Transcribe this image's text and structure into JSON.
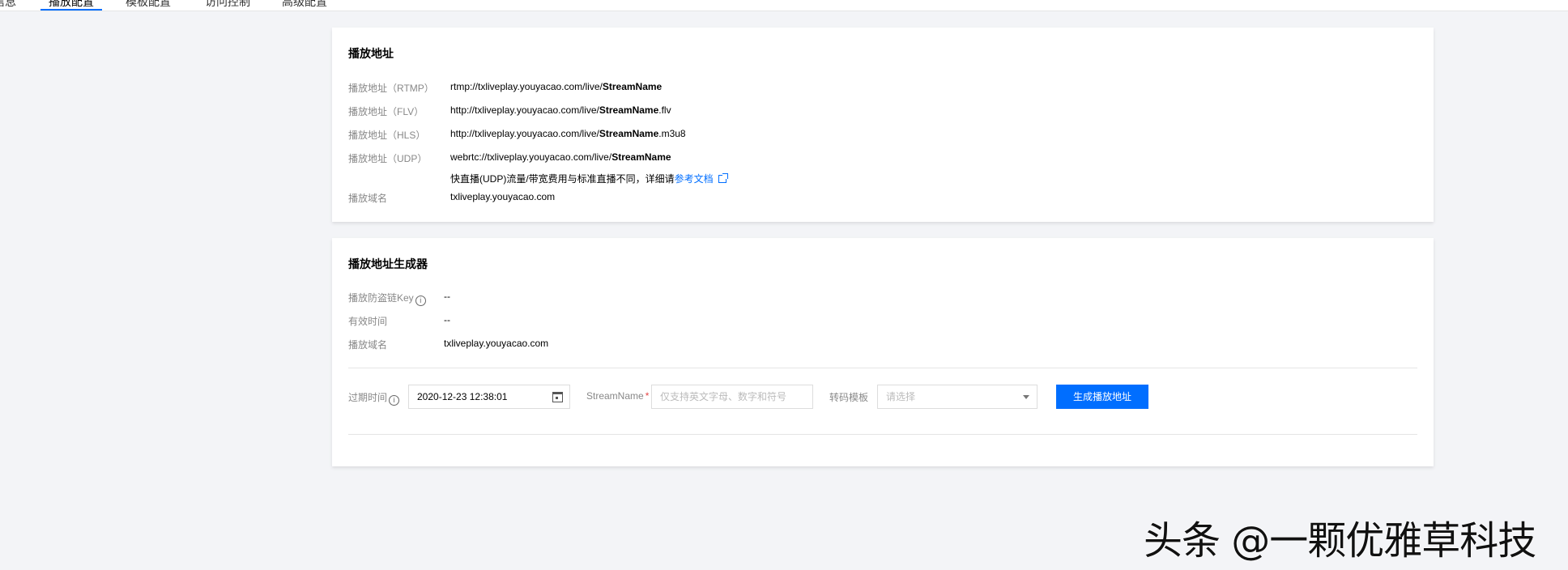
{
  "tabs": [
    {
      "label": "信息"
    },
    {
      "label": "播放配置"
    },
    {
      "label": "模板配置"
    },
    {
      "label": "访问控制"
    },
    {
      "label": "高级配置"
    }
  ],
  "play_address": {
    "title": "播放地址",
    "rows": [
      {
        "label": "播放地址（RTMP）",
        "prefix": "rtmp://txliveplay.youyacao.com/live/",
        "bold": "StreamName",
        "suffix": ""
      },
      {
        "label": "播放地址（FLV）",
        "prefix": "http://txliveplay.youyacao.com/live/",
        "bold": "StreamName",
        "suffix": ".flv"
      },
      {
        "label": "播放地址（HLS）",
        "prefix": "http://txliveplay.youyacao.com/live/",
        "bold": "StreamName",
        "suffix": ".m3u8"
      },
      {
        "label": "播放地址（UDP）",
        "prefix": "webrtc://txliveplay.youyacao.com/live/",
        "bold": "StreamName",
        "suffix": ""
      }
    ],
    "udp_hint": "快直播(UDP)流量/带宽费用与标准直播不同，详细请",
    "udp_hint_link": "参考文档",
    "domain_label": "播放域名",
    "domain_value": "txliveplay.youyacao.com"
  },
  "generator": {
    "title": "播放地址生成器",
    "key_label": "播放防盗链Key",
    "key_value": "--",
    "valid_label": "有效时间",
    "valid_value": "--",
    "domain_label": "播放域名",
    "domain_value": "txliveplay.youyacao.com",
    "expire_label": "过期时间",
    "expire_value": "2020-12-23 12:38:01",
    "stream_label": "StreamName",
    "stream_placeholder": "仅支持英文字母、数字和符号",
    "template_label": "转码模板",
    "template_placeholder": "请选择",
    "generate_button": "生成播放地址"
  },
  "watermark": "头条 @一颗优雅草科技",
  "colors": {
    "accent": "#006eff",
    "required": "#e54545"
  }
}
